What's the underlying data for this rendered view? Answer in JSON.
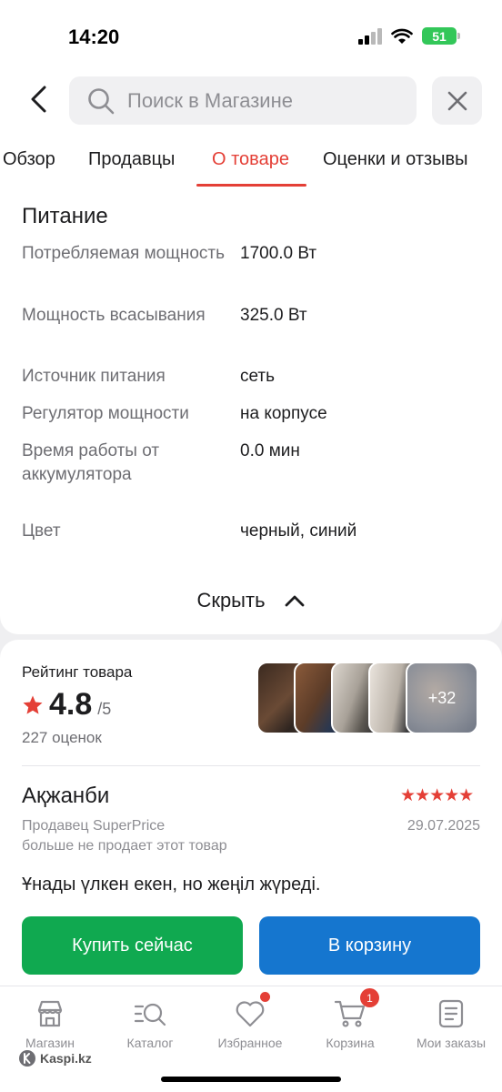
{
  "status_bar": {
    "time": "14:20",
    "battery": "51"
  },
  "search": {
    "placeholder": "Поиск в Магазине"
  },
  "tabs": [
    {
      "label": "Обзор"
    },
    {
      "label": "Продавцы"
    },
    {
      "label": "О товаре"
    },
    {
      "label": "Оценки и отзывы"
    }
  ],
  "active_tab": "О товаре",
  "specs": {
    "section_title": "Питание",
    "rows": [
      {
        "label": "Потребляемая мощность",
        "value": "1700.0 Вт"
      },
      {
        "label": "Мощность всасывания",
        "value": "325.0 Вт"
      },
      {
        "label": "Источник питания",
        "value": "сеть"
      },
      {
        "label": "Регулятор мощности",
        "value": "на корпусе"
      },
      {
        "label": "Время работы от аккумулятора",
        "value": "0.0 мин"
      },
      {
        "label": "Цвет",
        "value": "черный, синий"
      }
    ],
    "hide_label": "Скрыть"
  },
  "rating": {
    "title": "Рейтинг товара",
    "value": "4.8",
    "max": "/5",
    "count": "227 оценок",
    "more_photos": "+32"
  },
  "review": {
    "author": "Ақжанби",
    "stars": "★★★★★",
    "seller": "Продавец SuperPrice",
    "date": "29.07.2025",
    "note": "больше не продает этот товар",
    "text": "Ұнады үлкен екен, но жеңіл жүреді."
  },
  "actions": {
    "buy": "Купить сейчас",
    "cart": "В корзину"
  },
  "bottom_nav": [
    {
      "label": "Магазин",
      "icon": "store-icon"
    },
    {
      "label": "Каталог",
      "icon": "catalog-search-icon"
    },
    {
      "label": "Избранное",
      "icon": "heart-icon"
    },
    {
      "label": "Корзина",
      "icon": "cart-icon",
      "badge": "1"
    },
    {
      "label": "Мои заказы",
      "icon": "orders-icon"
    }
  ],
  "brand": "Kaspi.kz",
  "colors": {
    "accent": "#e43f36",
    "buy": "#10a950",
    "cart": "#1576cf"
  }
}
